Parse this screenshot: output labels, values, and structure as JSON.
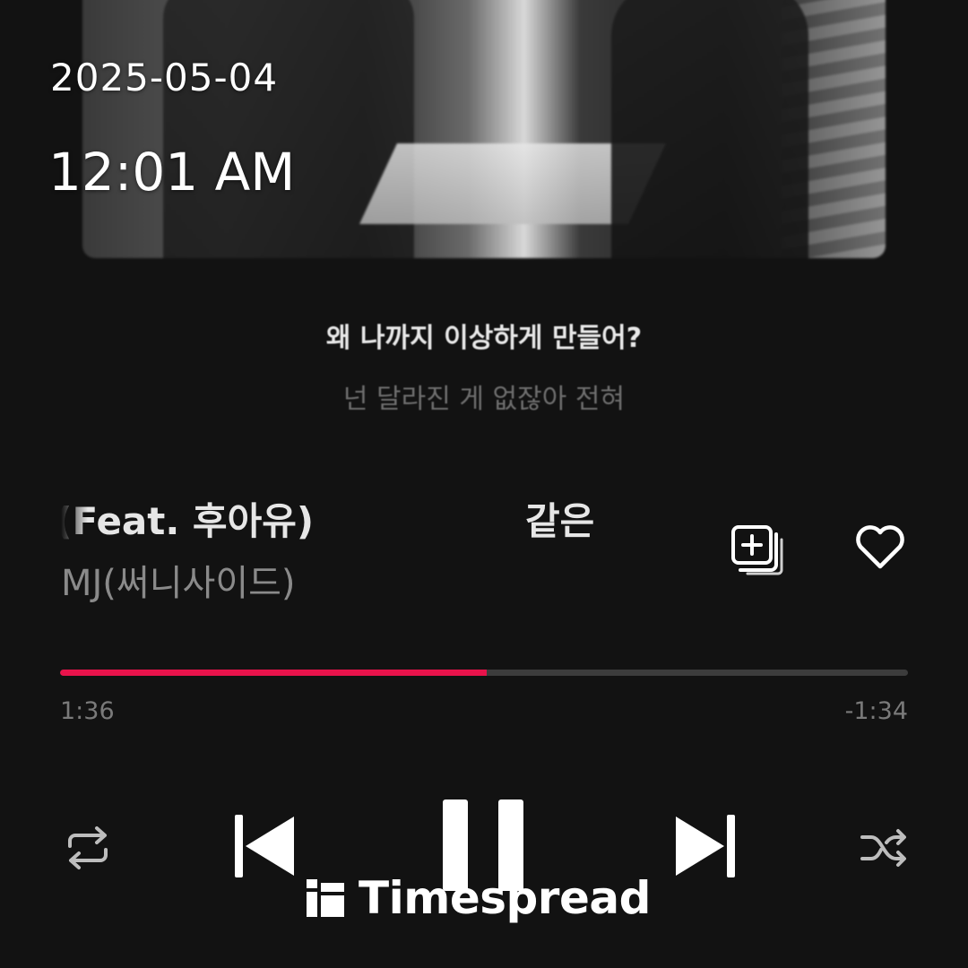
{
  "status": {
    "date": "2025-05-04",
    "time": "12:01 AM"
  },
  "album_art": {
    "icon": "album-cover-image"
  },
  "lyrics": {
    "current": "왜 나까지 이상하게 만들어?",
    "next": "넌 달라진 게 없잖아 전혀"
  },
  "track": {
    "title_visible_1": "트 (Feat. 후아유)",
    "title_visible_2": "같은",
    "artist": "MJ(써니사이드)"
  },
  "actions": {
    "add_icon": "add-to-playlist-icon",
    "like_icon": "heart-icon"
  },
  "playback": {
    "elapsed": "1:36",
    "remaining": "-1:34",
    "progress_fraction": 0.503,
    "accent_color": "#e8134b"
  },
  "controls": {
    "repeat_icon": "repeat-icon",
    "previous_icon": "skip-previous-icon",
    "pause_icon": "pause-icon",
    "next_icon": "skip-next-icon",
    "shuffle_icon": "shuffle-icon"
  },
  "watermark": {
    "text": "Timespread"
  }
}
